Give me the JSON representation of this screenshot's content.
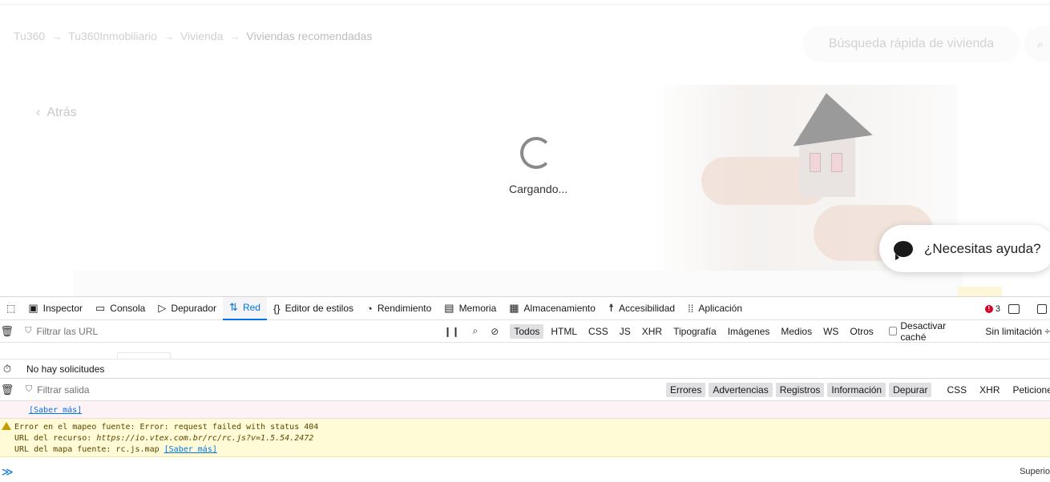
{
  "breadcrumb": {
    "items": [
      "Tu360",
      "Tu360Inmobiliario",
      "Vivienda"
    ],
    "current": "Viviendas recomendadas"
  },
  "search": {
    "placeholder": "Búsqueda rápida de vivienda"
  },
  "back": {
    "label": "Atrás"
  },
  "loading": {
    "label": "Cargando..."
  },
  "chat": {
    "label": "¿Necesitas ayuda?"
  },
  "devtools": {
    "tabs": [
      {
        "label": "Inspector",
        "icon": "inspector-icon"
      },
      {
        "label": "Consola",
        "icon": "console-icon"
      },
      {
        "label": "Depurador",
        "icon": "debugger-icon"
      },
      {
        "label": "Red",
        "icon": "network-icon"
      },
      {
        "label": "Editor de estilos",
        "icon": "style-editor-icon"
      },
      {
        "label": "Rendimiento",
        "icon": "performance-icon"
      },
      {
        "label": "Memoria",
        "icon": "memory-icon"
      },
      {
        "label": "Almacenamiento",
        "icon": "storage-icon"
      },
      {
        "label": "Accesibilidad",
        "icon": "accessibility-icon"
      },
      {
        "label": "Aplicación",
        "icon": "application-icon"
      }
    ],
    "active_tab": "Red",
    "error_count": "3",
    "network": {
      "filter_placeholder": "Filtrar las URL",
      "types": [
        "Todos",
        "HTML",
        "CSS",
        "JS",
        "XHR",
        "Tipografía",
        "Imágenes",
        "Medios",
        "WS",
        "Otros"
      ],
      "selected_type": "Todos",
      "disable_cache": "Desactivar caché",
      "throttling": "Sin limitación ÷",
      "empty_status": "No hay solicitudes"
    },
    "console": {
      "filter_placeholder": "Filtrar salida",
      "levels": [
        "Errores",
        "Advertencias",
        "Registros",
        "Información",
        "Depurar"
      ],
      "requests": [
        "CSS",
        "XHR",
        "Peticiones"
      ],
      "error_link": "[Saber más]",
      "warning": {
        "line1": "Error en el mapeo fuente: Error: request failed with status 404",
        "line2_label": "URL del recurso: ",
        "line2_url": "https://io.vtex.com.br/rc/rc.js?v=1.5.54.2472",
        "line3_label": "URL del mapa fuente: rc.js.map ",
        "line3_link": "[Saber más]"
      },
      "prompt": "≫",
      "position_label": "Superio"
    }
  },
  "colors": {
    "accent": "#0074e8",
    "error": "#d70022",
    "warning_bg": "#fffbd6",
    "error_bg": "#fdf2f5"
  }
}
